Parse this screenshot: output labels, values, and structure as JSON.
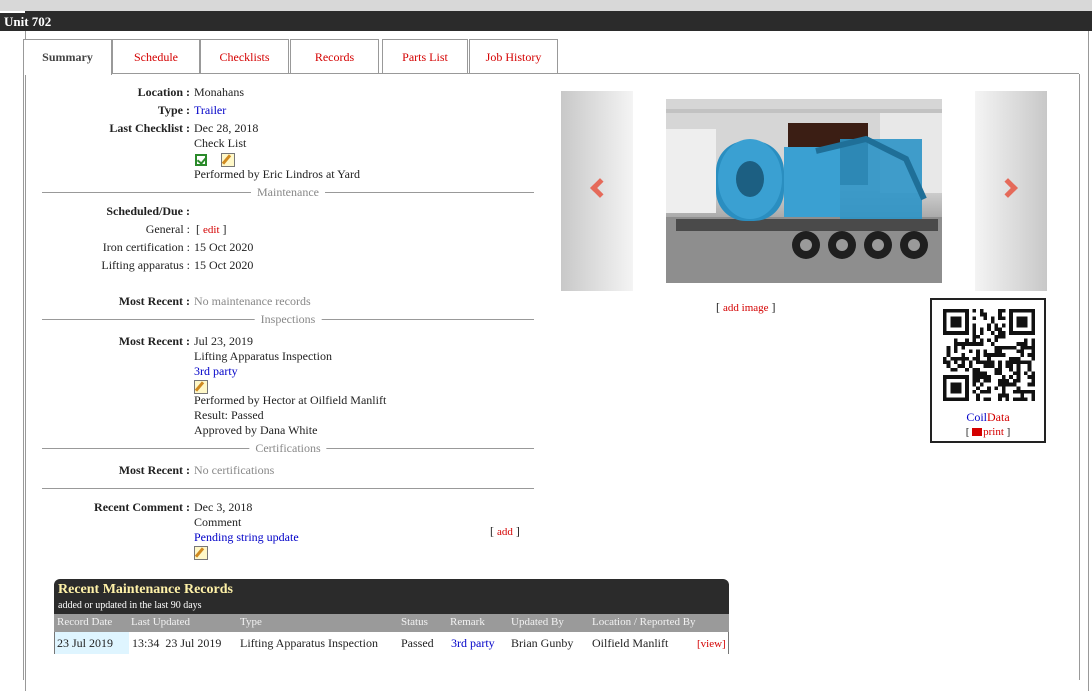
{
  "window": {
    "title": "Unit 702"
  },
  "tabs": [
    {
      "label": "Summary",
      "active": true
    },
    {
      "label": "Schedule"
    },
    {
      "label": "Checklists"
    },
    {
      "label": "Records"
    },
    {
      "label": "Parts List"
    },
    {
      "label": "Job History"
    }
  ],
  "summary": {
    "location_label": "Location :",
    "location": "Monahans",
    "type_label": "Type :",
    "type": "Trailer",
    "last_checklist_label": "Last Checklist :",
    "last_checklist_date": "Dec 28, 2018",
    "last_checklist_name": "Check List",
    "last_checklist_performed": "Performed by Eric Lindros at Yard"
  },
  "maintenance": {
    "section_title": "Maintenance",
    "scheduled_label": "Scheduled/Due :",
    "general_label": "General :",
    "edit_open": "[",
    "edit_link": "edit",
    "edit_close": "]",
    "iron_label": "Iron certification :",
    "iron_value": "15 Oct 2020",
    "lifting_label": "Lifting apparatus :",
    "lifting_value": "15 Oct 2020",
    "most_recent_label": "Most Recent :",
    "most_recent_value": "No maintenance records"
  },
  "inspections": {
    "section_title": "Inspections",
    "most_recent_label": "Most Recent :",
    "date": "Jul 23, 2019",
    "name": "Lifting Apparatus Inspection",
    "remark": "3rd party",
    "performed": "Performed by Hector at Oilfield Manlift",
    "result": "Result: Passed",
    "approved": "Approved by Dana White"
  },
  "certifications": {
    "section_title": "Certifications",
    "most_recent_label": "Most Recent :",
    "most_recent_value": "No certifications"
  },
  "comment": {
    "label": "Recent Comment :",
    "date": "Dec 3, 2018",
    "type": "Comment",
    "text": "Pending string update",
    "add_open": "[",
    "add_link": "add",
    "add_close": "]"
  },
  "gallery": {
    "add_open": "[",
    "add_link": "add image",
    "add_close": "]"
  },
  "qr": {
    "brand_blue": "Coil",
    "brand_red": "Data",
    "print_open": "[",
    "print_link": "print",
    "print_close": "]"
  },
  "recent_records": {
    "title": "Recent Maintenance Records",
    "subtitle": "added or updated in the last 90 days",
    "columns": [
      "Record Date",
      "Last Updated",
      "Type",
      "Status",
      "Remark",
      "Updated By",
      "Location / Reported By"
    ],
    "rows": [
      {
        "record_date": "23 Jul 2019",
        "last_updated": "13:34  23 Jul 2019",
        "type": "Lifting Apparatus Inspection",
        "status": "Passed",
        "remark": "3rd party",
        "updated_by": "Brian Gunby",
        "location": "Oilfield Manlift",
        "action": "[view]"
      }
    ]
  },
  "colors": {
    "link_red": "#d40000",
    "link_blue": "#0000c8",
    "header_dark": "#2b2b2b",
    "title_yellow": "#fff2a8"
  }
}
